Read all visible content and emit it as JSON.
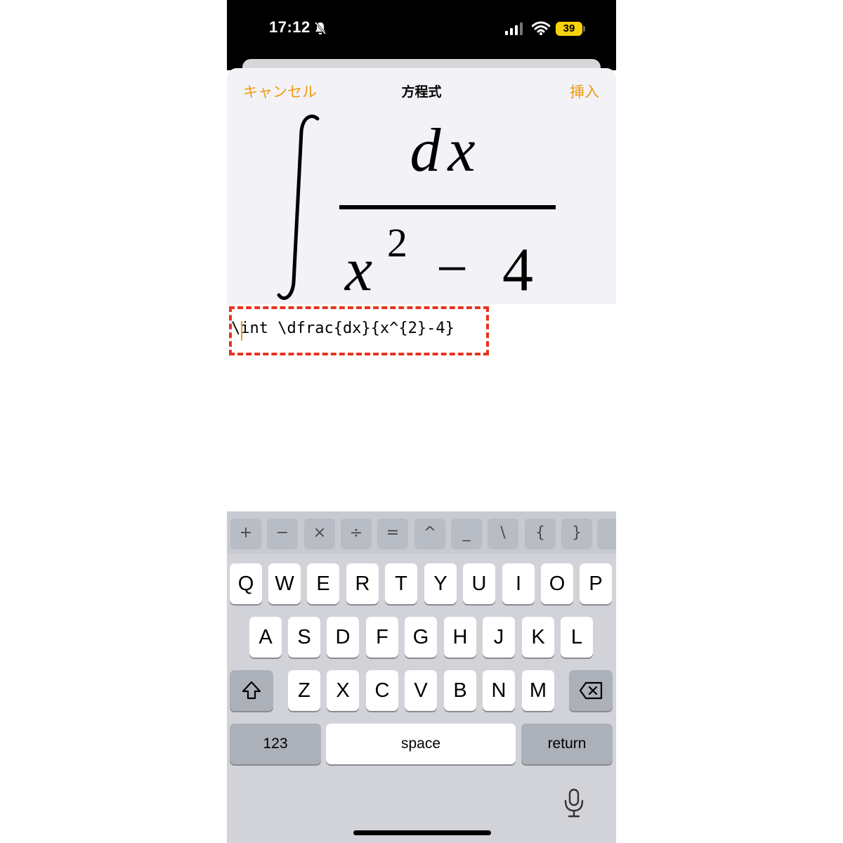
{
  "status_bar": {
    "time": "17:12",
    "battery": "39"
  },
  "sheet": {
    "cancel_label": "キャンセル",
    "title": "方程式",
    "insert_label": "挿入"
  },
  "equation": {
    "numerator": "dx",
    "denominator_base": "x",
    "exponent": "2",
    "operator": "−",
    "constant": "4"
  },
  "latex_input": {
    "value": "\\int \\dfrac{dx}{x^{2}-4}"
  },
  "keyboard": {
    "symbol_row": [
      "+",
      "−",
      "×",
      "÷",
      "=",
      "^",
      "_",
      "\\",
      "{",
      "}"
    ],
    "row1": [
      "Q",
      "W",
      "E",
      "R",
      "T",
      "Y",
      "U",
      "I",
      "O",
      "P"
    ],
    "row2": [
      "A",
      "S",
      "D",
      "F",
      "G",
      "H",
      "J",
      "K",
      "L"
    ],
    "row3": [
      "Z",
      "X",
      "C",
      "V",
      "B",
      "N",
      "M"
    ],
    "numbers_label": "123",
    "space_label": "space",
    "return_label": "return"
  },
  "colors": {
    "accent": "#f29a10",
    "highlight": "#e8321e"
  }
}
